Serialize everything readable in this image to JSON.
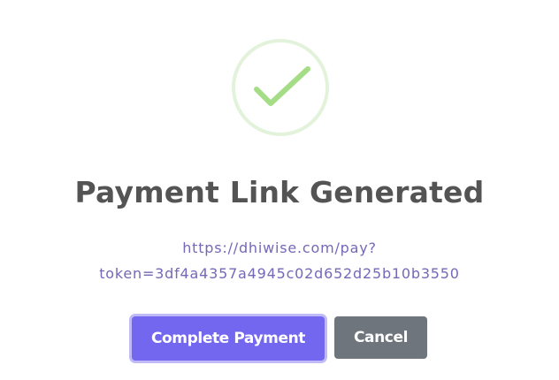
{
  "dialog": {
    "icon": "checkmark-success-icon",
    "title": "Payment Link Generated",
    "link_line1": "https://dhiwise.com/pay?",
    "link_line2": "token=3df4a4357a4945c02d652d25b10b3550",
    "confirm_label": "Complete Payment",
    "cancel_label": "Cancel"
  },
  "colors": {
    "success_ring": "#e3f3db",
    "success_check": "#a5dc86",
    "title_text": "#545454",
    "link_text": "#7468b8",
    "primary_button": "#7367f0",
    "primary_focus_ring": "#c0bbf7",
    "cancel_button": "#6e757d"
  }
}
